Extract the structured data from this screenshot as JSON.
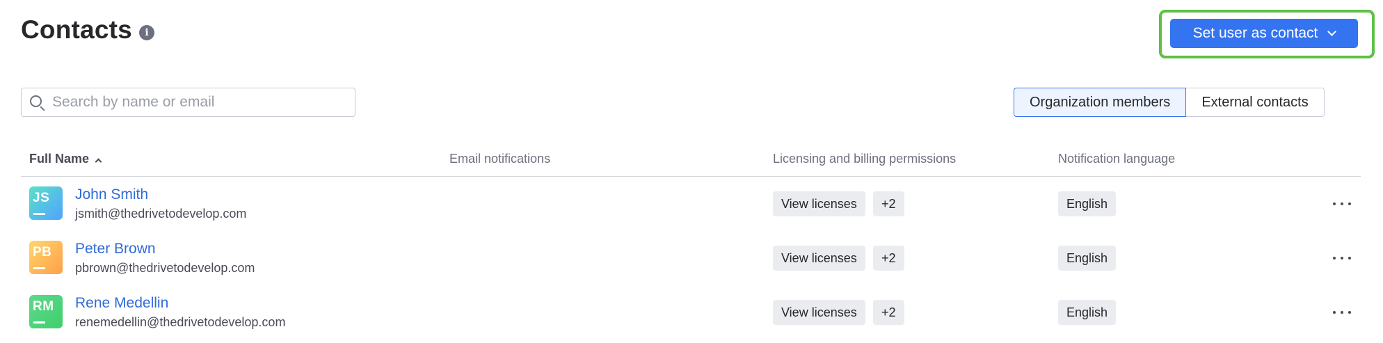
{
  "header": {
    "title": "Contacts",
    "info_glyph": "i",
    "cta_label": "Set user as contact"
  },
  "search": {
    "placeholder": "Search by name or email",
    "value": ""
  },
  "segments": [
    {
      "label": "Organization members",
      "selected": true
    },
    {
      "label": "External contacts",
      "selected": false
    }
  ],
  "table": {
    "columns": [
      "Full Name",
      "Email notifications",
      "Licensing and billing permissions",
      "Notification language"
    ],
    "rows": [
      {
        "initials": "JS",
        "name": "John Smith",
        "email": "jsmith@thedrivetodevelop.com",
        "permission": "View licenses",
        "extra": "+2",
        "language": "English",
        "avatar_colors": [
          "#5be0c9",
          "#4fa3ff"
        ]
      },
      {
        "initials": "PB",
        "name": "Peter Brown",
        "email": "pbrown@thedrivetodevelop.com",
        "permission": "View licenses",
        "extra": "+2",
        "language": "English",
        "avatar_colors": [
          "#ffd66b",
          "#ff9f4a"
        ]
      },
      {
        "initials": "RM",
        "name": "Rene Medellin",
        "email": "renemedellin@thedrivetodevelop.com",
        "permission": "View licenses",
        "extra": "+2",
        "language": "English",
        "avatar_colors": [
          "#5fd88a",
          "#3fcf6e"
        ]
      }
    ]
  },
  "colors": {
    "accent": "#3574f0",
    "highlight": "#5fbf46",
    "link": "#2f6bd6"
  }
}
